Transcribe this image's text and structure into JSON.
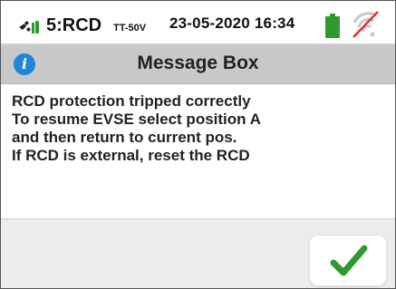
{
  "status_bar": {
    "mode": "5:RCD",
    "system": "TT-50V",
    "datetime": "23-05-2020  16:34",
    "icons": [
      "plug-icon",
      "battery-icon",
      "wifi-disabled-icon"
    ]
  },
  "titlebar": {
    "icon": "info-icon",
    "info_glyph": "i",
    "title": "Message Box"
  },
  "message": {
    "lines": [
      "RCD protection tripped correctly",
      "To resume EVSE select position A",
      "and then return to current pos.",
      "If RCD is external, reset the RCD"
    ]
  },
  "footer": {
    "ok_icon": "check-icon"
  },
  "colors": {
    "accent_green": "#2e9b2e",
    "info_blue": "#1e88d6",
    "wifi_strike": "#e03030"
  }
}
